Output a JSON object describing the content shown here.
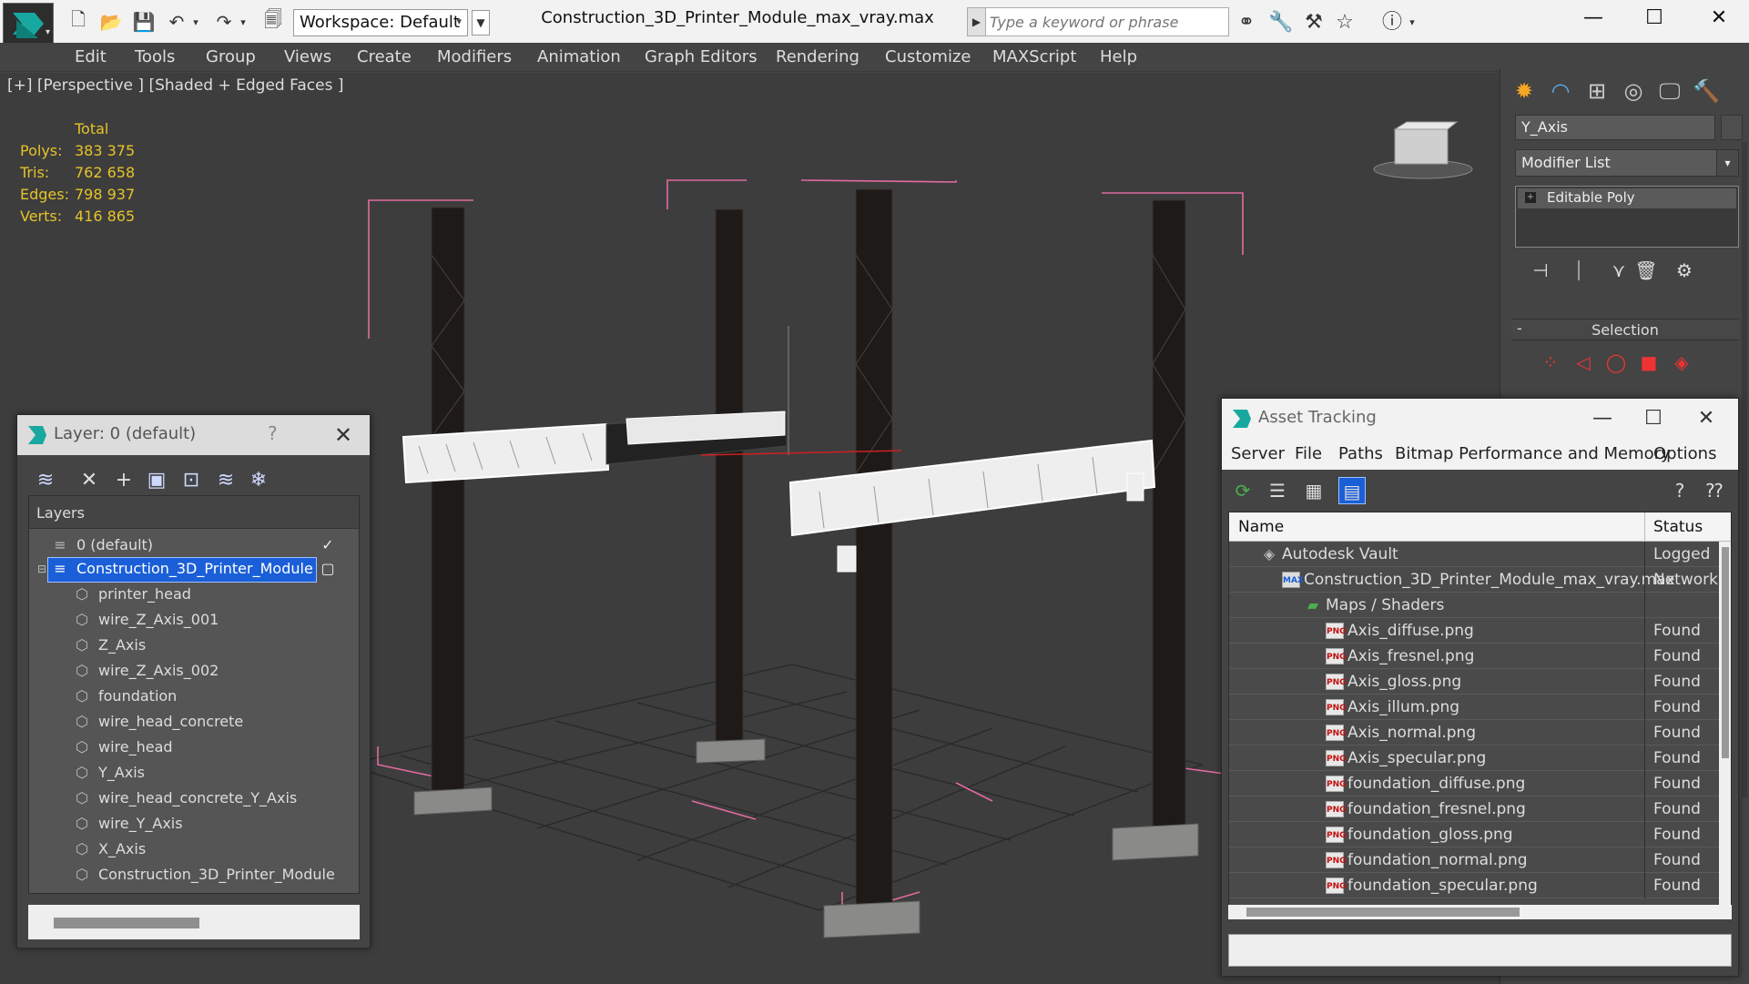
{
  "window": {
    "title": "Construction_3D_Printer_Module_max_vray.max",
    "workspace": "Workspace: Default",
    "search_placeholder": "Type a keyword or phrase"
  },
  "menubar": [
    "Edit",
    "Tools",
    "Group",
    "Views",
    "Create",
    "Modifiers",
    "Animation",
    "Graph Editors",
    "Rendering",
    "Customize",
    "MAXScript",
    "Help"
  ],
  "viewport": {
    "label": "[+] [Perspective ] [Shaded + Edged Faces ]",
    "stats": {
      "header": "Total",
      "rows": [
        {
          "label": "Polys:",
          "value": "383 375"
        },
        {
          "label": "Tris:",
          "value": "762 658"
        },
        {
          "label": "Edges:",
          "value": "798 937"
        },
        {
          "label": "Verts:",
          "value": "416 865"
        }
      ]
    }
  },
  "command_panel": {
    "object_name": "Y_Axis",
    "modifier_list": "Modifier List",
    "stack_item": "Editable Poly",
    "rollout": "Selection"
  },
  "layer_dialog": {
    "title": "Layer: 0 (default)",
    "help": "?",
    "column": "Layers",
    "layers": [
      {
        "label": "0 (default)"
      },
      {
        "label": "Construction_3D_Printer_Module"
      },
      {
        "label": "printer_head"
      },
      {
        "label": "wire_Z_Axis_001"
      },
      {
        "label": "Z_Axis"
      },
      {
        "label": "wire_Z_Axis_002"
      },
      {
        "label": "foundation"
      },
      {
        "label": "wire_head_concrete"
      },
      {
        "label": "wire_head"
      },
      {
        "label": "Y_Axis"
      },
      {
        "label": "wire_head_concrete_Y_Axis"
      },
      {
        "label": "wire_Y_Axis"
      },
      {
        "label": "X_Axis"
      },
      {
        "label": "Construction_3D_Printer_Module"
      }
    ]
  },
  "asset_dialog": {
    "title": "Asset Tracking",
    "menu": [
      "Server",
      "File",
      "Paths",
      "Bitmap Performance and Memory",
      "Options"
    ],
    "col_name": "Name",
    "col_status": "Status",
    "rows": [
      {
        "name": "Autodesk Vault",
        "status": "Logged"
      },
      {
        "name": "Construction_3D_Printer_Module_max_vray.max",
        "status": "Network"
      },
      {
        "name": "Maps / Shaders",
        "status": ""
      },
      {
        "name": "Axis_diffuse.png",
        "status": "Found"
      },
      {
        "name": "Axis_fresnel.png",
        "status": "Found"
      },
      {
        "name": "Axis_gloss.png",
        "status": "Found"
      },
      {
        "name": "Axis_illum.png",
        "status": "Found"
      },
      {
        "name": "Axis_normal.png",
        "status": "Found"
      },
      {
        "name": "Axis_specular.png",
        "status": "Found"
      },
      {
        "name": "foundation_diffuse.png",
        "status": "Found"
      },
      {
        "name": "foundation_fresnel.png",
        "status": "Found"
      },
      {
        "name": "foundation_gloss.png",
        "status": "Found"
      },
      {
        "name": "foundation_normal.png",
        "status": "Found"
      },
      {
        "name": "foundation_specular.png",
        "status": "Found"
      }
    ]
  },
  "colors": {
    "selection": "#1a5fd8",
    "stats": "#e6c329",
    "bbox": "#e26ba0"
  }
}
